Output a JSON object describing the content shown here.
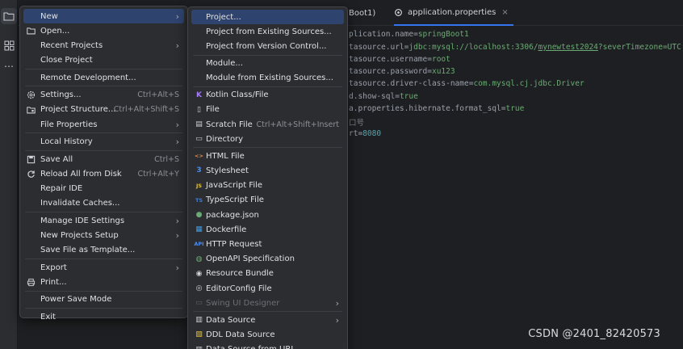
{
  "editor": {
    "tabs": [
      {
        "label": "Boot1)",
        "active": false
      },
      {
        "label": "application.properties",
        "active": true,
        "close": "×"
      }
    ],
    "lines": [
      {
        "key": "plication.name",
        "eq": "=",
        "value": "springBoot1"
      },
      {
        "key": "tasource.url",
        "eq": "=",
        "v1": "jdbc:mysql://localhost:3306/",
        "v2": "mynewtest2024",
        "v3": "?severTimezone=UTC"
      },
      {
        "key": "tasource.username",
        "eq": "=",
        "value": "root"
      },
      {
        "key": "tasource.password",
        "eq": "=",
        "value": "xu123"
      },
      {
        "key": "tasource.driver-class-name",
        "eq": "=",
        "value": "com.mysql.cj.jdbc.Driver"
      },
      {
        "key": "d.show-sql",
        "eq": "=",
        "value": "true"
      },
      {
        "key": "a.properties.hibernate.format_sql",
        "eq": "=",
        "value": "true"
      },
      {
        "comment": "口号"
      },
      {
        "key": "rt",
        "eq": "=",
        "value": "8080"
      }
    ]
  },
  "file_menu": [
    {
      "label": "New",
      "arrow": "›",
      "selected": true
    },
    {
      "label": "Open...",
      "icon": "folder-icon"
    },
    {
      "label": "Recent Projects",
      "arrow": "›"
    },
    {
      "label": "Close Project"
    },
    {
      "sep": true
    },
    {
      "label": "Remote Development..."
    },
    {
      "sep": true
    },
    {
      "label": "Settings...",
      "icon": "gear-icon",
      "shortcut": "Ctrl+Alt+S"
    },
    {
      "label": "Project Structure...",
      "icon": "project-structure-icon",
      "shortcut": "Ctrl+Alt+Shift+S"
    },
    {
      "label": "File Properties",
      "arrow": "›"
    },
    {
      "sep": true
    },
    {
      "label": "Local History",
      "arrow": "›"
    },
    {
      "sep": true
    },
    {
      "label": "Save All",
      "icon": "save-icon",
      "shortcut": "Ctrl+S"
    },
    {
      "label": "Reload All from Disk",
      "icon": "reload-icon",
      "shortcut": "Ctrl+Alt+Y"
    },
    {
      "label": "Repair IDE"
    },
    {
      "label": "Invalidate Caches..."
    },
    {
      "sep": true
    },
    {
      "label": "Manage IDE Settings",
      "arrow": "›"
    },
    {
      "label": "New Projects Setup",
      "arrow": "›"
    },
    {
      "label": "Save File as Template..."
    },
    {
      "sep": true
    },
    {
      "label": "Export",
      "arrow": "›"
    },
    {
      "label": "Print...",
      "icon": "print-icon"
    },
    {
      "sep": true
    },
    {
      "label": "Power Save Mode"
    },
    {
      "sep": true
    },
    {
      "label": "Exit"
    }
  ],
  "new_menu": [
    {
      "label": "Project...",
      "selected": true
    },
    {
      "label": "Project from Existing Sources..."
    },
    {
      "label": "Project from Version Control..."
    },
    {
      "sep": true
    },
    {
      "label": "Module..."
    },
    {
      "label": "Module from Existing Sources..."
    },
    {
      "sep": true
    },
    {
      "label": "Kotlin Class/File",
      "icon": "kotlin-icon",
      "icon_glyph": "K",
      "icon_color": "#a97bff"
    },
    {
      "label": "File",
      "icon": "file-icon",
      "icon_glyph": "▯",
      "icon_color": "#cfd1d6"
    },
    {
      "label": "Scratch File",
      "icon": "scratch-file-icon",
      "icon_glyph": "▤",
      "icon_color": "#cfd1d6",
      "shortcut": "Ctrl+Alt+Shift+Insert"
    },
    {
      "label": "Directory",
      "icon": "folder-icon",
      "icon_glyph": "▭",
      "icon_color": "#cfd1d6"
    },
    {
      "sep": true
    },
    {
      "label": "HTML File",
      "icon": "html-icon",
      "icon_glyph": "<>",
      "icon_color": "#e2884f"
    },
    {
      "label": "Stylesheet",
      "icon": "css-icon",
      "icon_glyph": "3",
      "icon_color": "#4a8cf7"
    },
    {
      "label": "JavaScript File",
      "icon": "javascript-icon",
      "icon_glyph": "JS",
      "icon_color": "#e3c33c"
    },
    {
      "label": "TypeScript File",
      "icon": "typescript-icon",
      "icon_glyph": "TS",
      "icon_color": "#3f7ee0"
    },
    {
      "label": "package.json",
      "icon": "npm-icon",
      "icon_glyph": "●",
      "icon_color": "#6aab73"
    },
    {
      "label": "Dockerfile",
      "icon": "docker-icon",
      "icon_glyph": "▦",
      "icon_color": "#3f9ae0"
    },
    {
      "label": "HTTP Request",
      "icon": "api-icon",
      "icon_glyph": "API",
      "icon_color": "#4a8cf7"
    },
    {
      "label": "OpenAPI Specification",
      "icon": "openapi-icon",
      "icon_glyph": "◍",
      "icon_color": "#6aab73"
    },
    {
      "label": "Resource Bundle",
      "icon": "resource-bundle-icon",
      "icon_glyph": "◉",
      "icon_color": "#cfd1d6"
    },
    {
      "label": "EditorConfig File",
      "icon": "editorconfig-icon",
      "icon_glyph": "◎",
      "icon_color": "#cfd1d6"
    },
    {
      "label": "Swing UI Designer",
      "icon": "swing-icon",
      "icon_glyph": "▭",
      "icon_color": "#5e6166",
      "arrow": "›",
      "disabled": true
    },
    {
      "sep": true
    },
    {
      "label": "Data Source",
      "icon": "database-icon",
      "icon_glyph": "▥",
      "icon_color": "#cfd1d6",
      "arrow": "›"
    },
    {
      "label": "DDL Data Source",
      "icon": "ddl-icon",
      "icon_glyph": "▧",
      "icon_color": "#e3c33c"
    },
    {
      "label": "Data Source from URL",
      "icon": "url-datasource-icon",
      "icon_glyph": "▥",
      "icon_color": "#cfd1d6"
    }
  ],
  "watermark": "CSDN @2401_82420573",
  "colors": {
    "selection": "#2e436e",
    "menu_bg": "#2b2d30",
    "editor_bg": "#1e1f22",
    "string": "#6aab73"
  }
}
